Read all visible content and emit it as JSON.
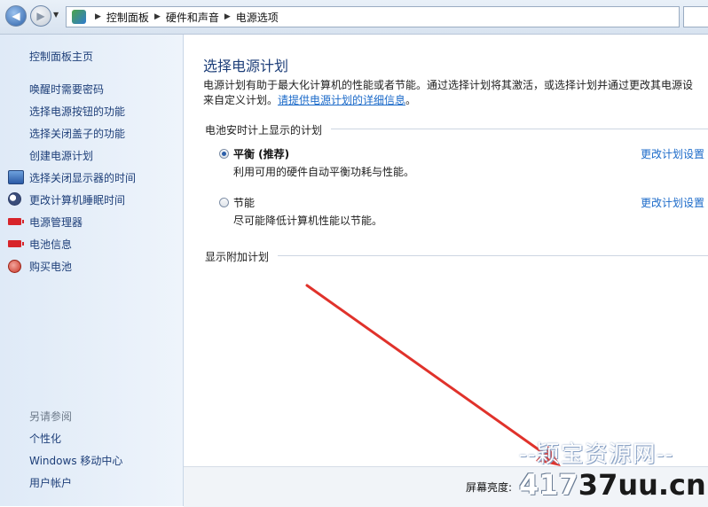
{
  "breadcrumb": [
    "控制面板",
    "硬件和声音",
    "电源选项"
  ],
  "sidebar": {
    "home": "控制面板主页",
    "items": [
      {
        "label": "唤醒时需要密码",
        "icon": ""
      },
      {
        "label": "选择电源按钮的功能",
        "icon": ""
      },
      {
        "label": "选择关闭盖子的功能",
        "icon": ""
      },
      {
        "label": "创建电源计划",
        "icon": ""
      },
      {
        "label": "选择关闭显示器的时间",
        "icon": "monitor-icon"
      },
      {
        "label": "更改计算机睡眠时间",
        "icon": "moon-icon"
      },
      {
        "label": "电源管理器",
        "icon": "battery-icon"
      },
      {
        "label": "电池信息",
        "icon": "battery-icon"
      },
      {
        "label": "购买电池",
        "icon": "globe-icon"
      }
    ],
    "see_also_title": "另请参阅",
    "see_also": [
      "个性化",
      "Windows 移动中心",
      "用户帐户"
    ]
  },
  "main": {
    "title": "选择电源计划",
    "desc_line1": "电源计划有助于最大化计算机的性能或者节能。通过选择计划将其激活，或选择计划并通过更改其电源设",
    "desc_line2_prefix": "来自定义计划。",
    "desc_link": "请提供电源计划的详细信息",
    "desc_line2_suffix": "。",
    "section_battery": "电池安时计上显示的计划",
    "plans": [
      {
        "name": "平衡 (推荐)",
        "desc": "利用可用的硬件自动平衡功耗与性能。",
        "selected": true,
        "link": "更改计划设置"
      },
      {
        "name": "节能",
        "desc": "尽可能降低计算机性能以节能。",
        "selected": false,
        "link": "更改计划设置"
      }
    ],
    "section_additional": "显示附加计划",
    "brightness_label": "屏幕亮度:"
  },
  "watermark": {
    "line1": "--颖宝资源网--",
    "line2_a": "417",
    "line2_b": "37uu.cn"
  },
  "colors": {
    "link": "#1b6ac9",
    "sidebar_link": "#1e3f79",
    "annotation_arrow": "#e0322b"
  }
}
